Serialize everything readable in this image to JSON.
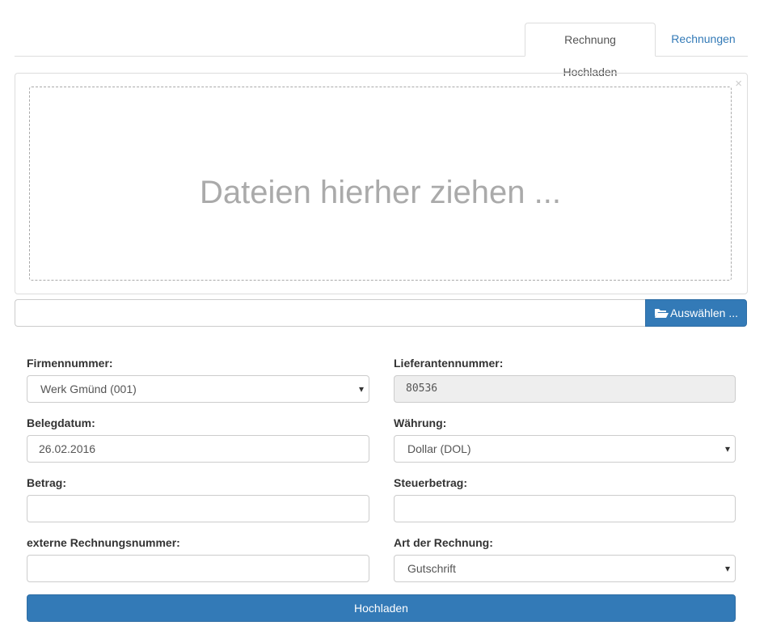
{
  "tabs": [
    {
      "label": "Rechnung Hochladen",
      "active": true
    },
    {
      "label": "Rechnungen",
      "active": false
    }
  ],
  "dropzone": {
    "text": "Dateien hierher ziehen ...",
    "close_symbol": "×"
  },
  "file_select": {
    "caption_value": "",
    "button_label": "Auswählen ...",
    "button_icon": "folder-open-icon"
  },
  "form": {
    "firmennummer": {
      "label": "Firmennummer:",
      "value": "Werk Gmünd (001)"
    },
    "lieferantennummer": {
      "label": "Lieferantennummer:",
      "value": "80536"
    },
    "belegdatum": {
      "label": "Belegdatum:",
      "value": "26.02.2016"
    },
    "waehrung": {
      "label": "Währung:",
      "value": "Dollar (DOL)"
    },
    "betrag": {
      "label": "Betrag:",
      "value": ""
    },
    "steuerbetrag": {
      "label": "Steuerbetrag:",
      "value": ""
    },
    "externe_nummer": {
      "label": "externe Rechnungsnummer:",
      "value": ""
    },
    "art": {
      "label": "Art der Rechnung:",
      "value": "Gutschrift"
    },
    "submit_label": "Hochladen"
  },
  "colors": {
    "primary": "#337ab7",
    "link": "#337ab7",
    "readonly_bg": "#eeeeee",
    "placeholder_text": "#aaaaaa"
  }
}
